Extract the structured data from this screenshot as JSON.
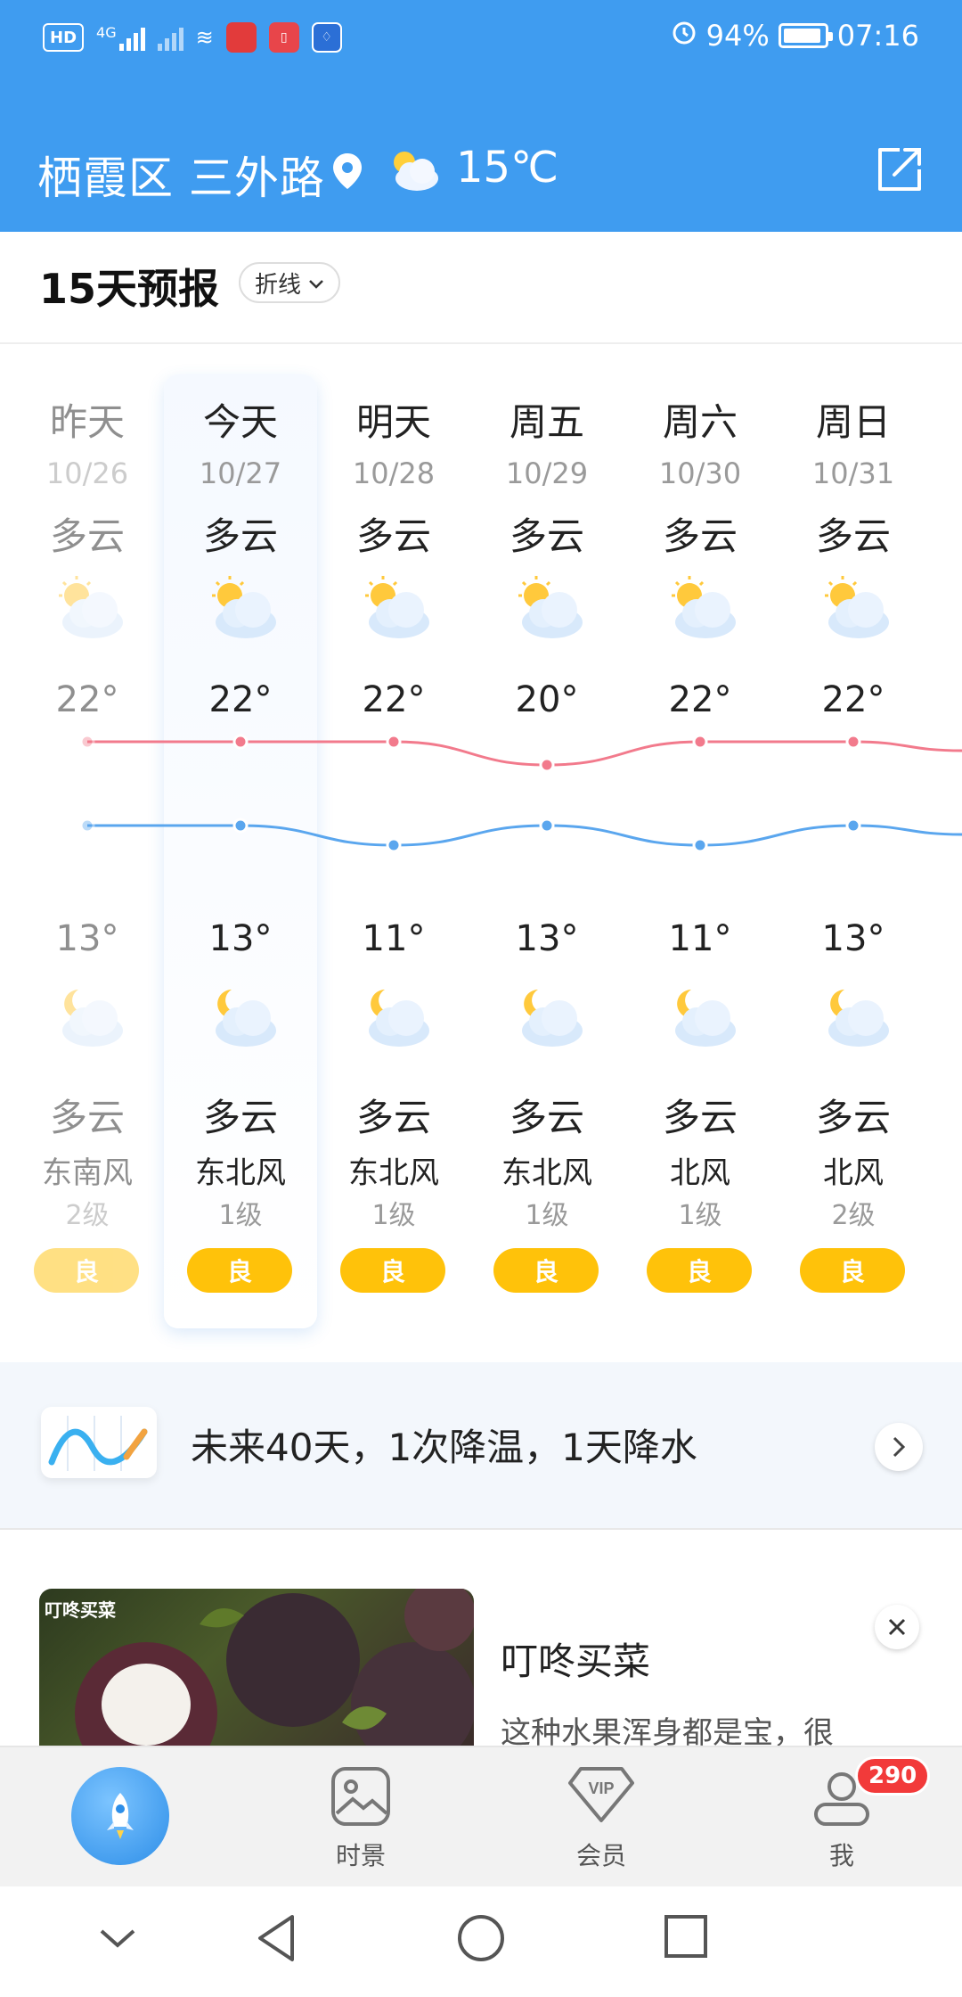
{
  "status_bar": {
    "hd": "HD",
    "signal": "4G",
    "battery": "94%",
    "battery_level": 0.94,
    "time": "07:16"
  },
  "header": {
    "location": "栖霞区 三外路",
    "temperature": "15℃"
  },
  "forecast": {
    "title": "15天预报",
    "mode": "折线",
    "days": [
      {
        "name": "昨天",
        "date": "10/26",
        "day_cond": "多云",
        "high": "22°",
        "low": "13°",
        "night_cond": "多云",
        "wind_dir": "东南风",
        "wind_level": "2级",
        "aqi": "良",
        "high_value": 22,
        "low_value": 13,
        "past": true
      },
      {
        "name": "今天",
        "date": "10/27",
        "day_cond": "多云",
        "high": "22°",
        "low": "13°",
        "night_cond": "多云",
        "wind_dir": "东北风",
        "wind_level": "1级",
        "aqi": "良",
        "high_value": 22,
        "low_value": 13,
        "past": false
      },
      {
        "name": "明天",
        "date": "10/28",
        "day_cond": "多云",
        "high": "22°",
        "low": "11°",
        "night_cond": "多云",
        "wind_dir": "东北风",
        "wind_level": "1级",
        "aqi": "良",
        "high_value": 22,
        "low_value": 11,
        "past": false
      },
      {
        "name": "周五",
        "date": "10/29",
        "day_cond": "多云",
        "high": "20°",
        "low": "13°",
        "night_cond": "多云",
        "wind_dir": "东北风",
        "wind_level": "1级",
        "aqi": "良",
        "high_value": 20,
        "low_value": 13,
        "past": false
      },
      {
        "name": "周六",
        "date": "10/30",
        "day_cond": "多云",
        "high": "22°",
        "low": "11°",
        "night_cond": "多云",
        "wind_dir": "北风",
        "wind_level": "1级",
        "aqi": "良",
        "high_value": 22,
        "low_value": 11,
        "past": false
      },
      {
        "name": "周日",
        "date": "10/31",
        "day_cond": "多云",
        "high": "22°",
        "low": "13°",
        "night_cond": "多云",
        "wind_dir": "北风",
        "wind_level": "2级",
        "aqi": "良",
        "high_value": 22,
        "low_value": 13,
        "past": false
      }
    ]
  },
  "banner": {
    "text": "未来40天，1次降温，1天降水"
  },
  "ad": {
    "image_tag": "叮咚买菜",
    "title": "叮咚买菜",
    "description": "这种水果浑身都是宝，很"
  },
  "bottom_nav": {
    "items": [
      {
        "label": ""
      },
      {
        "label": "时景"
      },
      {
        "label": "会员"
      },
      {
        "label": "我"
      }
    ],
    "badge": "290"
  },
  "colors": {
    "header_bg": "#3f9cf0",
    "high_curve": "#f27a8c",
    "low_curve": "#5aa6ee",
    "aqi_good": "#ffc20a"
  }
}
